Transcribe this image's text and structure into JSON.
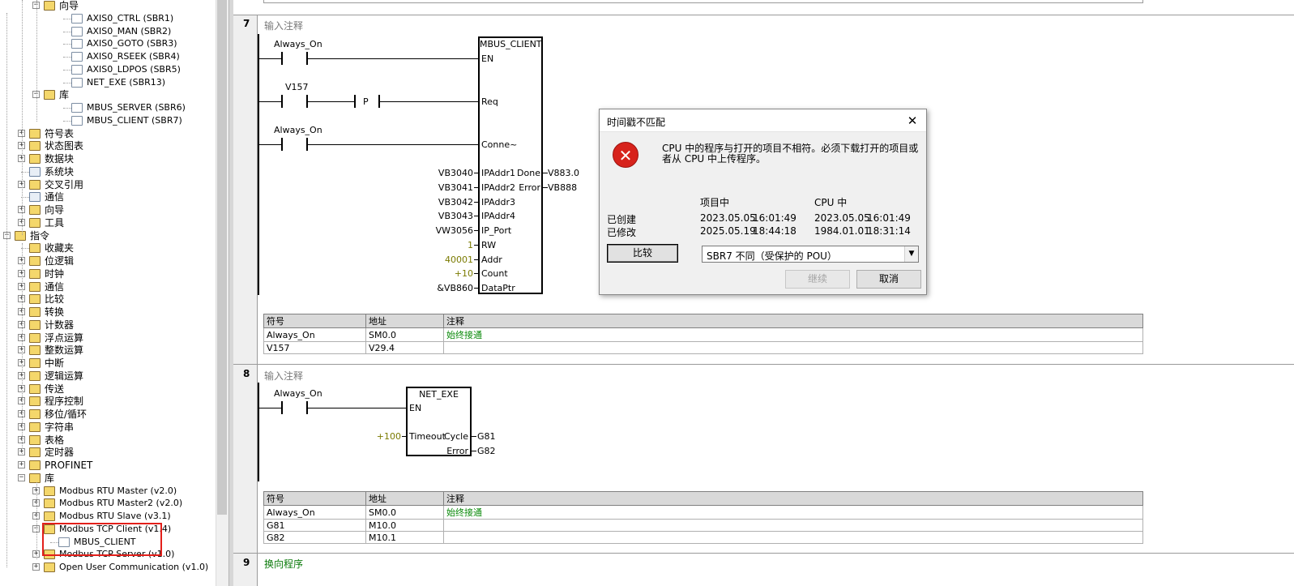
{
  "tree": {
    "items": [
      {
        "label": "向导",
        "expander": "⊟"
      },
      {
        "label": "AXIS0_CTRL (SBR1)"
      },
      {
        "label": "AXIS0_MAN (SBR2)"
      },
      {
        "label": "AXIS0_GOTO (SBR3)"
      },
      {
        "label": "AXIS0_RSEEK (SBR4)"
      },
      {
        "label": "AXIS0_LDPOS (SBR5)"
      },
      {
        "label": "NET_EXE (SBR13)"
      },
      {
        "label": "库",
        "expander": "⊟"
      },
      {
        "label": "MBUS_SERVER (SBR6)"
      },
      {
        "label": "MBUS_CLIENT (SBR7)"
      },
      {
        "label": "符号表",
        "expander": "⊞"
      },
      {
        "label": "状态图表",
        "expander": "⊞"
      },
      {
        "label": "数据块",
        "expander": "⊞"
      },
      {
        "label": "系统块"
      },
      {
        "label": "交叉引用",
        "expander": "⊞"
      },
      {
        "label": "通信"
      },
      {
        "label": "向导",
        "expander": "⊞"
      },
      {
        "label": "工具",
        "expander": "⊞"
      },
      {
        "label": "指令",
        "expander": "⊟"
      },
      {
        "label": "收藏夹"
      },
      {
        "label": "位逻辑",
        "expander": "⊞"
      },
      {
        "label": "时钟",
        "expander": "⊞"
      },
      {
        "label": "通信",
        "expander": "⊞"
      },
      {
        "label": "比较",
        "expander": "⊞"
      },
      {
        "label": "转换",
        "expander": "⊞"
      },
      {
        "label": "计数器",
        "expander": "⊞"
      },
      {
        "label": "浮点运算",
        "expander": "⊞"
      },
      {
        "label": "整数运算",
        "expander": "⊞"
      },
      {
        "label": "中断",
        "expander": "⊞"
      },
      {
        "label": "逻辑运算",
        "expander": "⊞"
      },
      {
        "label": "传送",
        "expander": "⊞"
      },
      {
        "label": "程序控制",
        "expander": "⊞"
      },
      {
        "label": "移位/循环",
        "expander": "⊞"
      },
      {
        "label": "字符串",
        "expander": "⊞"
      },
      {
        "label": "表格",
        "expander": "⊞"
      },
      {
        "label": "定时器",
        "expander": "⊞"
      },
      {
        "label": "PROFINET",
        "expander": "⊞"
      },
      {
        "label": "库",
        "expander": "⊟"
      },
      {
        "label": "Modbus RTU Master (v2.0)",
        "expander": "⊞"
      },
      {
        "label": "Modbus RTU Master2 (v2.0)",
        "expander": "⊞"
      },
      {
        "label": "Modbus RTU Slave (v3.1)",
        "expander": "⊞"
      },
      {
        "label": "Modbus TCP Client (v1.4)",
        "expander": "⊟"
      },
      {
        "label": "MBUS_CLIENT"
      },
      {
        "label": "Modbus TCP Server (v1.0)",
        "expander": "⊞"
      },
      {
        "label": "Open User Communication (v1.0)",
        "expander": "⊞"
      }
    ]
  },
  "network7": {
    "number": "7",
    "comment": "输入注释",
    "contact1_label": "Always_On",
    "contact2_label": "V157",
    "p_label": "P",
    "contact3_label": "Always_On",
    "block_title": "MBUS_CLIENT",
    "pin_en": "EN",
    "pin_req": "Req",
    "pin_conn": "Conne~",
    "inputs": [
      {
        "pin": "IPAddr1",
        "operand": "VB3040"
      },
      {
        "pin": "IPAddr2",
        "operand": "VB3041"
      },
      {
        "pin": "IPAddr3",
        "operand": "VB3042"
      },
      {
        "pin": "IPAddr4",
        "operand": "VB3043"
      },
      {
        "pin": "IP_Port",
        "operand": "VW3056"
      },
      {
        "pin": "RW",
        "operand": "1"
      },
      {
        "pin": "Addr",
        "operand": "40001"
      },
      {
        "pin": "Count",
        "operand": "+10"
      },
      {
        "pin": "DataPtr",
        "operand": "&VB860"
      }
    ],
    "outputs": [
      {
        "pin": "Done",
        "operand": "V883.0"
      },
      {
        "pin": "Error",
        "operand": "VB888"
      }
    ],
    "table": {
      "headers": [
        "符号",
        "地址",
        "注释"
      ],
      "rows": [
        [
          "Always_On",
          "SM0.0",
          "始终接通"
        ],
        [
          "V157",
          "V29.4",
          ""
        ]
      ]
    }
  },
  "network8": {
    "number": "8",
    "comment": "输入注释",
    "contact_label": "Always_On",
    "block_title": "NET_EXE",
    "pin_en": "EN",
    "input_pin": "Timeout",
    "input_operand": "+100",
    "outputs": [
      {
        "pin": "Cycle",
        "operand": "G81"
      },
      {
        "pin": "Error",
        "operand": "G82"
      }
    ],
    "table": {
      "headers": [
        "符号",
        "地址",
        "注释"
      ],
      "rows": [
        [
          "Always_On",
          "SM0.0",
          "始终接通"
        ],
        [
          "G81",
          "M10.0",
          ""
        ],
        [
          "G82",
          "M10.1",
          ""
        ]
      ]
    }
  },
  "network9": {
    "number": "9",
    "title": "换向程序"
  },
  "dialog": {
    "title": "时间戳不匹配",
    "close": "✕",
    "icon": "error-icon",
    "icon_glyph": "✕",
    "message_line1": "CPU 中的程序与打开的项目不相符。必须下载打开的项目或",
    "message_line2": "者从 CPU 中上传程序。",
    "col_project": "项目中",
    "col_cpu": "CPU 中",
    "row_created": "已创建",
    "row_modified": "已修改",
    "created_project_date": "2023.05.05",
    "created_project_time": "16:01:49",
    "created_cpu_date": "2023.05.05",
    "created_cpu_time": "16:01:49",
    "modified_project_date": "2025.05.19",
    "modified_project_time": "18:44:18",
    "modified_cpu_date": "1984.01.01",
    "modified_cpu_time": "18:31:14",
    "compare_button": "比较",
    "select_value": "SBR7 不同（受保护的 POU）",
    "continue_button": "继续",
    "cancel_button": "取消"
  },
  "colors": {
    "error_red": "#d7231c",
    "highlight_red": "#e3201b",
    "comment_green": "#0a8a0a",
    "constant_olive": "#7a7a00"
  }
}
